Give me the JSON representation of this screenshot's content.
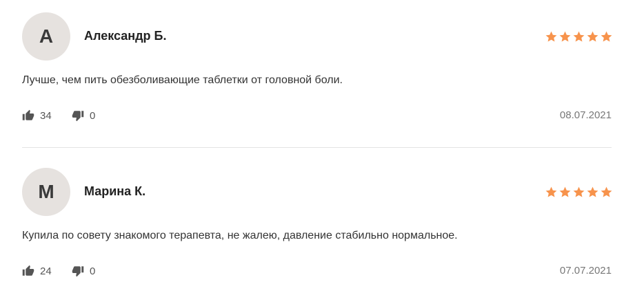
{
  "colors": {
    "star": "#f7934c",
    "avatar_bg": "#e6e2df",
    "divider": "#e3e3e3",
    "icon": "#555555"
  },
  "icons": {
    "like": "thumbs-up-icon",
    "dislike": "thumbs-down-icon",
    "rating": "star-icon"
  },
  "reviews": [
    {
      "initial": "А",
      "author": "Александр Б.",
      "rating": 5,
      "text": "Лучше, чем пить обезболивающие таблетки от головной боли.",
      "likes": "34",
      "dislikes": "0",
      "date": "08.07.2021"
    },
    {
      "initial": "М",
      "author": "Марина К.",
      "rating": 5,
      "text": "Купила по совету знакомого терапевта, не жалею, давление стабильно нормальное.",
      "likes": "24",
      "dislikes": "0",
      "date": "07.07.2021"
    }
  ]
}
